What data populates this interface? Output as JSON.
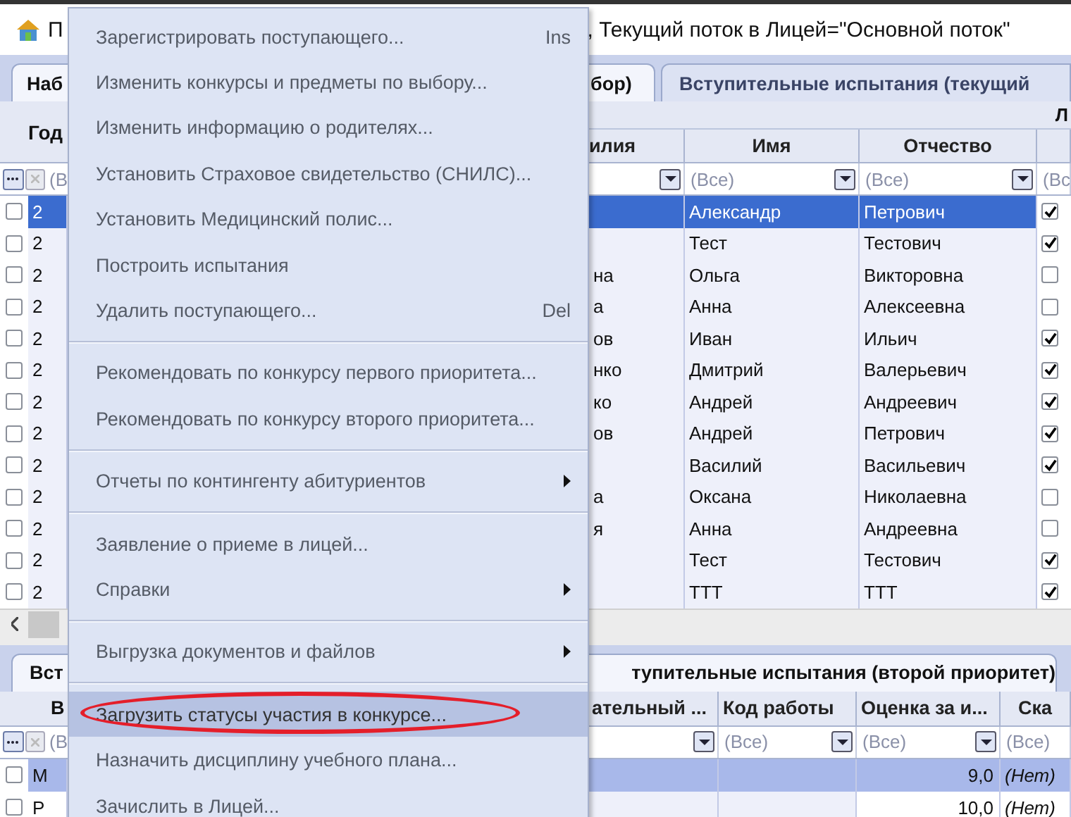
{
  "title": {
    "start": "П",
    "end": ", Текущий поток в Лицей=\"Основной поток\""
  },
  "tabs": [
    {
      "label_start": "Наб",
      "label_end": "бор)",
      "selected": true
    },
    {
      "label": "Вступительные испытания (текущий",
      "selected": false
    }
  ],
  "top_grid": {
    "year_header": "Год",
    "band_label": "Л",
    "columns": [
      "илия",
      "Имя",
      "Отчество"
    ],
    "filters": {
      "left": "(В",
      "name": "(Все)",
      "patronymic": "(Все)",
      "last": "(Вс"
    },
    "rows": [
      {
        "checked": false,
        "year": "2",
        "name": "Александр",
        "patronymic": "Петрович",
        "flag": true,
        "selected": true
      },
      {
        "checked": false,
        "year": "2",
        "name": "Тест",
        "patronymic": "Тестович",
        "flag": true,
        "selected": false
      },
      {
        "checked": false,
        "year": "2",
        "surname": "на",
        "name": "Ольга",
        "patronymic": "Викторовна",
        "flag": false,
        "selected": false
      },
      {
        "checked": false,
        "year": "2",
        "surname": "а",
        "name": "Анна",
        "patronymic": "Алексеевна",
        "flag": false,
        "selected": false
      },
      {
        "checked": false,
        "year": "2",
        "surname": "ов",
        "name": "Иван",
        "patronymic": "Ильич",
        "flag": true,
        "selected": false
      },
      {
        "checked": false,
        "year": "2",
        "surname": "нко",
        "name": "Дмитрий",
        "patronymic": "Валерьевич",
        "flag": true,
        "selected": false
      },
      {
        "checked": false,
        "year": "2",
        "surname": "ко",
        "name": "Андрей",
        "patronymic": "Андреевич",
        "flag": true,
        "selected": false
      },
      {
        "checked": false,
        "year": "2",
        "surname": "ов",
        "name": "Андрей",
        "patronymic": "Петрович",
        "flag": true,
        "selected": false
      },
      {
        "checked": false,
        "year": "2",
        "name": "Василий",
        "patronymic": "Васильевич",
        "flag": true,
        "selected": false
      },
      {
        "checked": false,
        "year": "2",
        "surname": "а",
        "name": "Оксана",
        "patronymic": "Николаевна",
        "flag": false,
        "selected": false
      },
      {
        "checked": false,
        "year": "2",
        "surname": "я",
        "name": "Анна",
        "patronymic": "Андреевна",
        "flag": false,
        "selected": false
      },
      {
        "checked": false,
        "year": "2",
        "name": "Тест",
        "patronymic": "Тестович",
        "flag": true,
        "selected": false
      },
      {
        "checked": false,
        "year": "2",
        "name": "ТТТ",
        "patronymic": "ТТТ",
        "flag": true,
        "selected": false
      }
    ]
  },
  "bottom_tabs": [
    {
      "label_start": "Вст",
      "label_end": "тупительные испытания (второй приоритет)",
      "selected": true
    }
  ],
  "bottom_grid": {
    "first_header": "В",
    "columns": [
      "ательный ...",
      "Код работы",
      "Оценка за и...",
      "Ска"
    ],
    "filters": {
      "left": "(В",
      "code": "(Все)",
      "score": "(Все)",
      "last": "(Все)"
    },
    "rows": [
      {
        "checked": false,
        "first": "М",
        "score": "9,0",
        "status": "(Нет)",
        "selected": true
      },
      {
        "checked": false,
        "first": "Р",
        "score": "10,0",
        "status": "(Нет)",
        "selected": false
      }
    ]
  },
  "menu": {
    "items": [
      {
        "kind": "item",
        "label": "Зарегистрировать поступающего...",
        "shortcut": "Ins",
        "submenu": false,
        "selected": false,
        "annotated": false
      },
      {
        "kind": "item",
        "label": "Изменить конкурсы и предметы по выбору...",
        "submenu": false,
        "selected": false,
        "annotated": false
      },
      {
        "kind": "item",
        "label": "Изменить информацию о родителях...",
        "submenu": false,
        "selected": false,
        "annotated": false
      },
      {
        "kind": "item",
        "label": "Установить Страховое свидетельство (СНИЛС)...",
        "submenu": false,
        "selected": false,
        "annotated": false
      },
      {
        "kind": "item",
        "label": "Установить Медицинский полис...",
        "submenu": false,
        "selected": false,
        "annotated": false
      },
      {
        "kind": "item",
        "label": "Построить испытания",
        "submenu": false,
        "selected": false,
        "annotated": false
      },
      {
        "kind": "item",
        "label": "Удалить поступающего...",
        "shortcut": "Del",
        "submenu": false,
        "selected": false,
        "annotated": false
      },
      {
        "kind": "separator"
      },
      {
        "kind": "item",
        "label": "Рекомендовать по конкурсу первого приоритета...",
        "submenu": false,
        "selected": false,
        "annotated": false
      },
      {
        "kind": "item",
        "label": "Рекомендовать по конкурсу второго приоритета...",
        "submenu": false,
        "selected": false,
        "annotated": false
      },
      {
        "kind": "separator"
      },
      {
        "kind": "item",
        "label": "Отчеты по контингенту абитуриентов",
        "submenu": true,
        "selected": false,
        "annotated": false
      },
      {
        "kind": "separator"
      },
      {
        "kind": "item",
        "label": "Заявление о приеме в лицей...",
        "submenu": false,
        "selected": false,
        "annotated": false
      },
      {
        "kind": "item",
        "label": "Справки",
        "submenu": true,
        "selected": false,
        "annotated": false
      },
      {
        "kind": "separator"
      },
      {
        "kind": "item",
        "label": "Выгрузка документов и файлов",
        "submenu": true,
        "selected": false,
        "annotated": false
      },
      {
        "kind": "separator"
      },
      {
        "kind": "item",
        "label": "Загрузить статусы участия в конкурсе...",
        "submenu": false,
        "selected": true,
        "annotated": true
      },
      {
        "kind": "item",
        "label": "Назначить дисциплину учебного плана...",
        "submenu": false,
        "selected": false,
        "annotated": false
      },
      {
        "kind": "item",
        "label": "Зачислить в Лицей...",
        "submenu": false,
        "selected": false,
        "annotated": false
      }
    ]
  }
}
